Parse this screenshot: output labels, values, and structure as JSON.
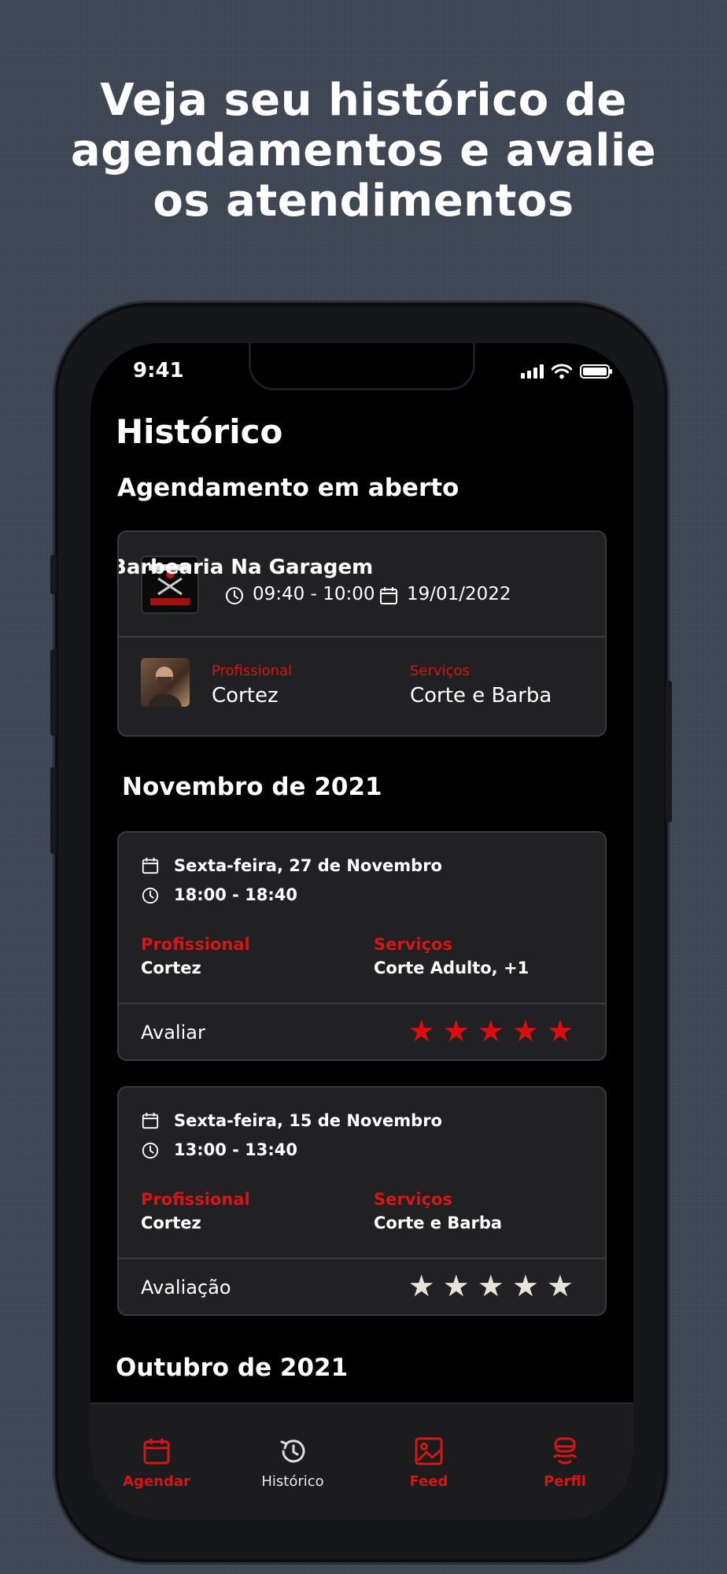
{
  "headline": {
    "line1": "Veja seu histórico de",
    "line2": "agendamentos e avalie",
    "line3": "os atendimentos"
  },
  "status_bar": {
    "time": "9:41"
  },
  "page_title": "Histórico",
  "open_section": {
    "title": "Agendamento em aberto",
    "shop_name": "Barbearia Na Garagem",
    "time": "09:40 - 10:00",
    "date": "19/01/2022",
    "professional_label": "Profissional",
    "professional": "Cortez",
    "services_label": "Serviços",
    "services": "Corte e Barba"
  },
  "month_nov": "Novembro de 2021",
  "history": [
    {
      "date": "Sexta-feira, 27 de Novembro",
      "time": "18:00 - 18:40",
      "professional_label": "Profissional",
      "professional": "Cortez",
      "services_label": "Serviços",
      "services": "Corte Adulto, +1",
      "rating_label": "Avaliar",
      "star_color": "#d80f0f",
      "stars": 5
    },
    {
      "date": "Sexta-feira, 15 de Novembro",
      "time": "13:00 - 13:40",
      "professional_label": "Profissional",
      "professional": "Cortez",
      "services_label": "Serviços",
      "services": "Corte e Barba",
      "rating_label": "Avaliação",
      "star_color": "#e6e3dc",
      "stars": 5
    }
  ],
  "month_oct": "Outubro de 2021",
  "tabbar": {
    "agendar": "Agendar",
    "historico": "Histórico",
    "feed": "Feed",
    "perfil": "Perfil",
    "active": "historico",
    "accent": "#d31616"
  }
}
